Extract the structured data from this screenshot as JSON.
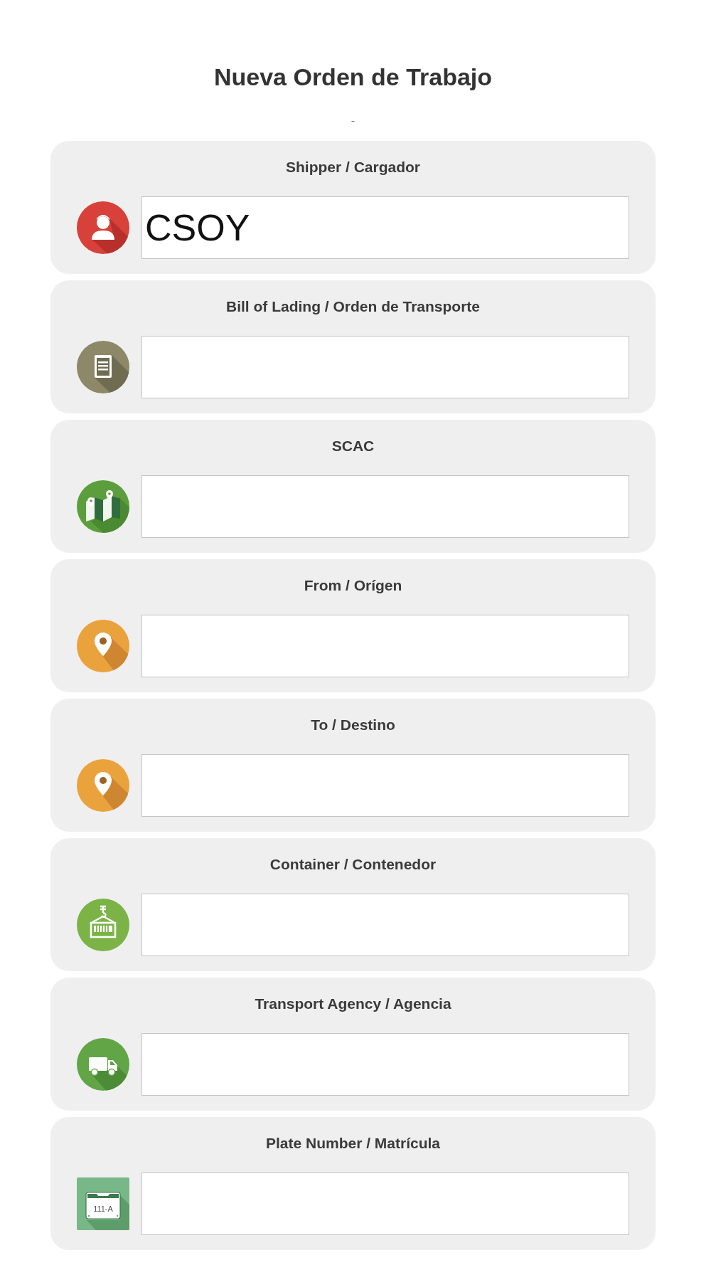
{
  "title": "Nueva Orden de Trabajo",
  "subtitle": "-",
  "fields": [
    {
      "kind": "shipper",
      "label": "Shipper / Cargador",
      "value": "CSOY"
    },
    {
      "kind": "lading",
      "label": "Bill of Lading / Orden de Transporte"
    },
    {
      "kind": "scac",
      "label": "SCAC"
    },
    {
      "kind": "origin",
      "label": "From / Orígen"
    },
    {
      "kind": "destination",
      "label": "To / Destino"
    },
    {
      "kind": "container",
      "label": "Container / Contenedor"
    },
    {
      "kind": "agency",
      "label": "Transport Agency / Agencia"
    },
    {
      "kind": "plate",
      "label": "Plate Number / Matrícula",
      "icon_text": "111-A"
    }
  ]
}
